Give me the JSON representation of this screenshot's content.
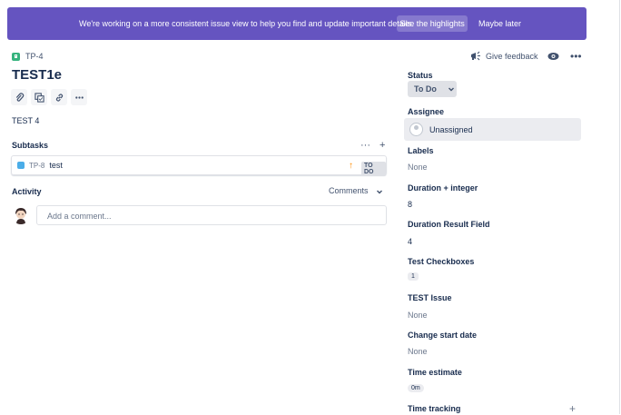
{
  "banner": {
    "message": "We're working on a more consistent issue view to help you find and update important details.",
    "highlights_btn": "See the highlights",
    "later_link": "Maybe later",
    "color": "#6554c0"
  },
  "issue": {
    "key": "TP-4",
    "title": "TEST1e",
    "description": "TEST 4"
  },
  "toolbar": {
    "icons": [
      "attachment-icon",
      "subtask-icon",
      "link-icon",
      "more-icon"
    ]
  },
  "subtasks": {
    "title": "Subtasks",
    "items": [
      {
        "key": "TP-8",
        "summary": "test",
        "priority": "↑",
        "status": "TO DO"
      }
    ]
  },
  "activity": {
    "title": "Activity",
    "filter": "Comments",
    "comment_placeholder": "Add a comment..."
  },
  "header_actions": {
    "feedback": "Give feedback"
  },
  "fields": {
    "status": {
      "label": "Status",
      "value": "To Do"
    },
    "assignee": {
      "label": "Assignee",
      "value": "Unassigned"
    },
    "labels": {
      "label": "Labels",
      "value": "None"
    },
    "duration_integer": {
      "label": "Duration + integer",
      "value": "8"
    },
    "duration_result": {
      "label": "Duration Result Field",
      "value": "4"
    },
    "test_checkboxes": {
      "label": "Test Checkboxes",
      "value": "1"
    },
    "test_issue": {
      "label": "TEST Issue",
      "value": "None"
    },
    "change_start_date": {
      "label": "Change start date",
      "value": "None"
    },
    "time_estimate": {
      "label": "Time estimate",
      "value": "0m"
    },
    "time_tracking": {
      "label": "Time tracking"
    }
  }
}
